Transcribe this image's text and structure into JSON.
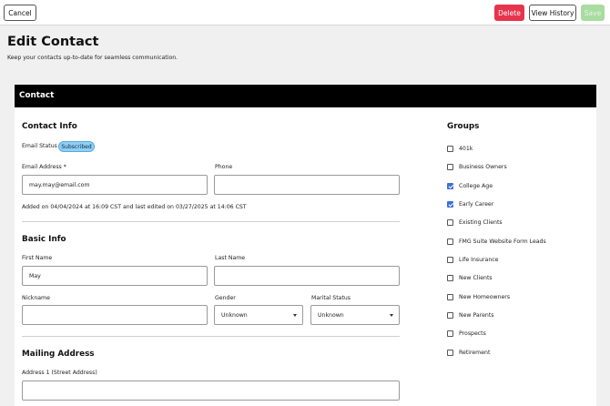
{
  "toolbar": {
    "cancel_label": "Cancel",
    "delete_label": "Delete",
    "history_label": "View History",
    "save_label": "Save"
  },
  "page": {
    "title": "Edit Contact",
    "subtitle": "Keep your contacts up-to-date for seamless communication."
  },
  "card": {
    "header": "Contact"
  },
  "contact_info": {
    "title": "Contact Info",
    "email_status_label": "Email Status",
    "email_status_badge": "Subscribed",
    "email_label": "Email Address *",
    "email_value": "may.may@email.com",
    "phone_label": "Phone",
    "phone_value": "",
    "audit_text": "Added on 04/04/2024 at 16:09 CST and last edited on 03/27/2025 at 14:06 CST"
  },
  "basic_info": {
    "title": "Basic Info",
    "first_name_label": "First Name",
    "first_name_value": "May",
    "last_name_label": "Last Name",
    "last_name_value": "",
    "nickname_label": "Nickname",
    "nickname_value": "",
    "gender_label": "Gender",
    "gender_value": "Unknown",
    "marital_label": "Marital Status",
    "marital_value": "Unknown"
  },
  "mailing_address": {
    "title": "Mailing Address",
    "address1_label": "Address 1 (Street Address)",
    "address1_value": ""
  },
  "groups": {
    "title": "Groups",
    "items": [
      {
        "label": "401k",
        "checked": false
      },
      {
        "label": "Business Owners",
        "checked": false
      },
      {
        "label": "College Age",
        "checked": true
      },
      {
        "label": "Early Career",
        "checked": true
      },
      {
        "label": "Existing Clients",
        "checked": false
      },
      {
        "label": "FMG Suite Website Form Leads",
        "checked": false
      },
      {
        "label": "Life Insurance",
        "checked": false
      },
      {
        "label": "New Clients",
        "checked": false
      },
      {
        "label": "New Homeowners",
        "checked": false
      },
      {
        "label": "New Parents",
        "checked": false
      },
      {
        "label": "Prospects",
        "checked": false
      },
      {
        "label": "Retirement",
        "checked": false
      }
    ]
  },
  "colors": {
    "delete": "#e8334d",
    "save_disabled": "#a8dca0",
    "badge": "#8fd0f5",
    "checkbox_checked": "#3d6fd6",
    "card_header": "#000000"
  }
}
